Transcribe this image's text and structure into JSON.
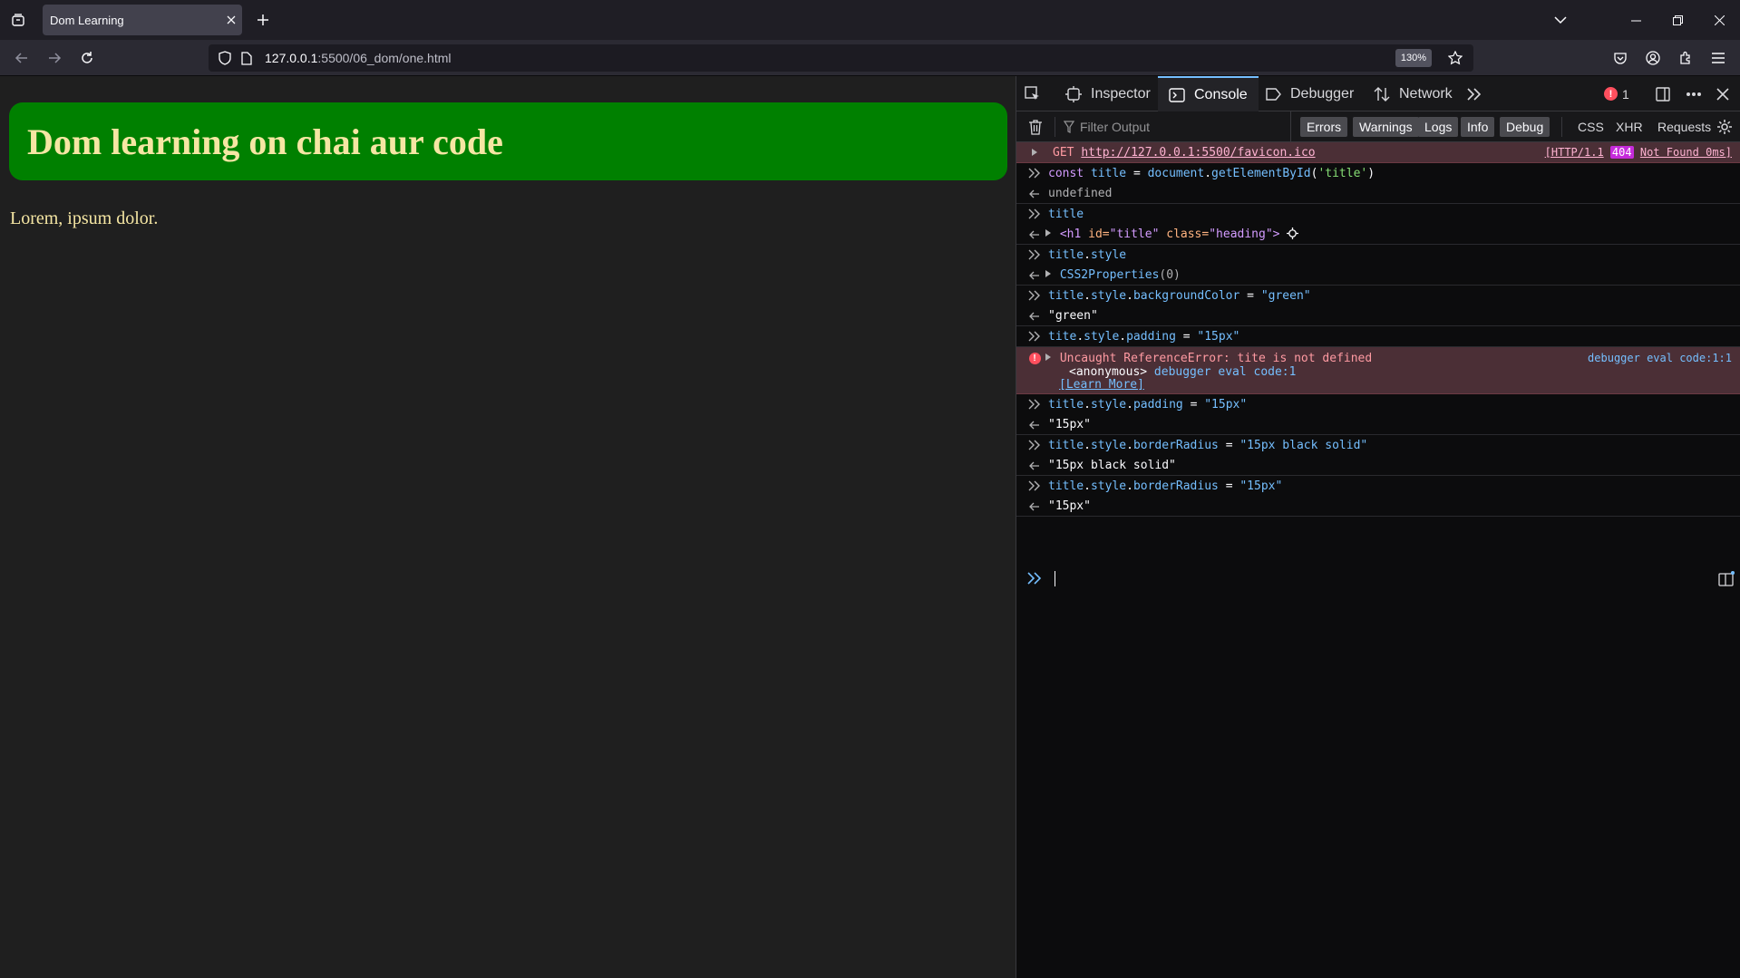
{
  "browser": {
    "tab_title": "Dom Learning",
    "url_host": "127.0.0.1",
    "url_rest": ":5500/06_dom/one.html",
    "zoom": "130%"
  },
  "page": {
    "heading": "Dom learning on chai aur code",
    "paragraph": "Lorem, ipsum dolor.",
    "heading_bg": "#008000",
    "text_color": "#f5e6a3"
  },
  "devtools": {
    "tabs": {
      "inspector": "Inspector",
      "console": "Console",
      "debugger": "Debugger",
      "network": "Network"
    },
    "error_count": "1",
    "filter_placeholder": "Filter Output",
    "filters": {
      "errors": "Errors",
      "warnings": "Warnings",
      "logs": "Logs",
      "info": "Info",
      "debug": "Debug",
      "css": "CSS",
      "xhr": "XHR",
      "requests": "Requests"
    },
    "console": {
      "net_get": {
        "method": "GET",
        "url": "http://127.0.0.1:5500/favicon.ico",
        "status_pre": "[HTTP/1.1",
        "status_code": "404",
        "status_post": "Not Found 0ms]"
      },
      "l1_kw": "const",
      "l1_var": "title",
      "l1_eq": "=",
      "l1_obj": "document",
      "l1_fn": "getElementById",
      "l1_arg": "'title'",
      "r1": "undefined",
      "l2": "title",
      "r2_tag": "<h1",
      "r2_id_attr": "id=",
      "r2_id_val": "\"title\"",
      "r2_class_attr": "class=",
      "r2_class_val": "\"heading\"",
      "r2_close": ">",
      "l3_obj": "title",
      "l3_prop": "style",
      "r3": "CSS2Properties",
      "r3_count": "(0)",
      "l4_obj": "title",
      "l4_prop1": "style",
      "l4_prop2": "backgroundColor",
      "l4_val": "\"green\"",
      "r4": "\"green\"",
      "l5_obj": "tite",
      "l5_prop1": "style",
      "l5_prop2": "padding",
      "l5_val": "\"15px\"",
      "err_msg": "Uncaught ReferenceError: tite is not defined",
      "err_src": "debugger eval code:1:1",
      "err_frame_fn": "<anonymous>",
      "err_frame_src": "debugger eval code:1",
      "err_learn": "[Learn More]",
      "l6_obj": "title",
      "l6_prop1": "style",
      "l6_prop2": "padding",
      "l6_val": "\"15px\"",
      "r6": "\"15px\"",
      "l7_obj": "title",
      "l7_prop1": "style",
      "l7_prop2": "borderRadius",
      "l7_val": "\"15px black solid\"",
      "r7": "\"15px black solid\"",
      "l8_obj": "title",
      "l8_prop1": "style",
      "l8_prop2": "borderRadius",
      "l8_val": "\"15px\"",
      "r8": "\"15px\""
    }
  }
}
